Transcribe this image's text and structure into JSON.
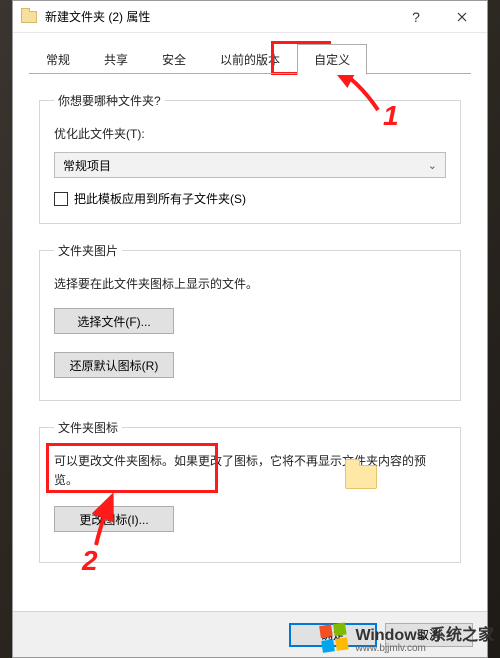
{
  "window": {
    "title": "新建文件夹 (2) 属性"
  },
  "tabs": {
    "t0": "常规",
    "t1": "共享",
    "t2": "安全",
    "t3": "以前的版本",
    "t4": "自定义"
  },
  "section1": {
    "legend": "你想要哪种文件夹?",
    "optimize_label": "优化此文件夹(T):",
    "select_value": "常规项目",
    "apply_checkbox": "把此模板应用到所有子文件夹(S)"
  },
  "section2": {
    "legend": "文件夹图片",
    "desc": "选择要在此文件夹图标上显示的文件。",
    "choose_btn": "选择文件(F)...",
    "restore_btn": "还原默认图标(R)"
  },
  "section3": {
    "legend": "文件夹图标",
    "desc": "可以更改文件夹图标。如果更改了图标，它将不再显示文件夹内容的预览。",
    "change_btn": "更改图标(I)..."
  },
  "dialog_buttons": {
    "ok": "确定",
    "cancel": "取消"
  },
  "annotations": {
    "n1": "1",
    "n2": "2"
  },
  "watermark": {
    "line1": "Windows 系统之家",
    "line2": "www.bjjmlv.com"
  }
}
